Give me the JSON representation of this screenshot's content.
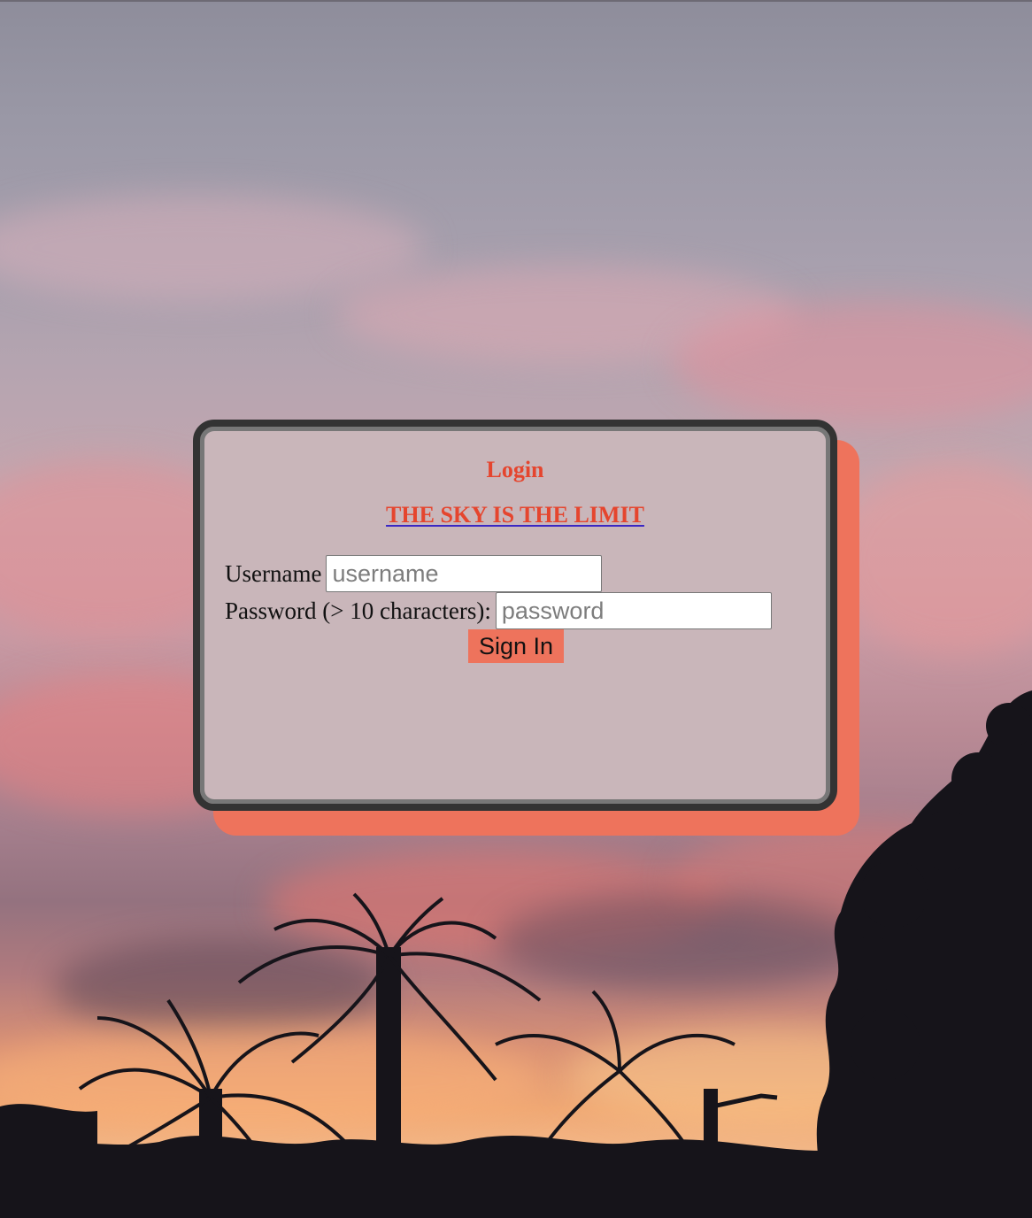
{
  "login_card": {
    "title": "Login",
    "tagline_link": "THE SKY IS THE LIMIT",
    "username": {
      "label": "Username",
      "placeholder": "username",
      "value": ""
    },
    "password": {
      "label": "Password (> 10 characters):",
      "placeholder": "password",
      "value": ""
    },
    "submit_label": "Sign In"
  },
  "colors": {
    "accent": "#e5452e",
    "button": "#ee735c",
    "card_background": "#c9b6ba",
    "card_border": "#333333",
    "link_underline": "#3a27c4"
  }
}
